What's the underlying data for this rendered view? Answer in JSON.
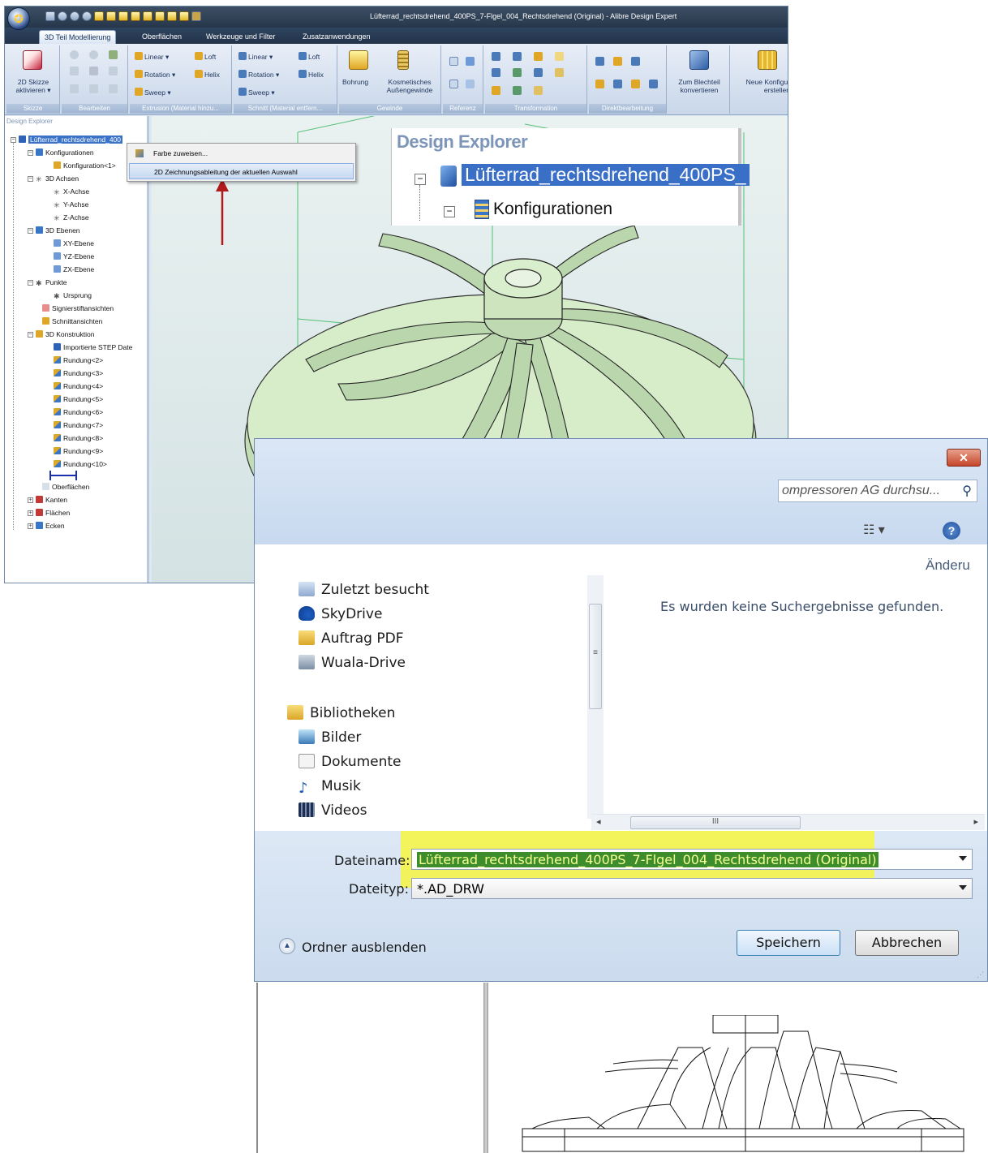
{
  "app": {
    "title": "Lüfterrad_rechtsdrehend_400PS_7-Flgel_004_Rechtsdrehend (Original) - Alibre Design Expert",
    "tabs": [
      "3D Teil Modellierung",
      "Oberflächen",
      "Werkzeuge und Filter",
      "Zusatzanwendungen"
    ],
    "ribbon": {
      "skizze_btn": "2D Skizze",
      "skizze_btn2": "aktivieren ▾",
      "ext_linear": "Linear ▾",
      "ext_rotation": "Rotation ▾",
      "ext_sweep": "Sweep ▾",
      "ext_loft": "Loft",
      "ext_helix": "Helix",
      "cut_linear": "Linear ▾",
      "cut_rotation": "Rotation ▾",
      "cut_sweep": "Sweep ▾",
      "cut_loft": "Loft",
      "cut_helix": "Helix",
      "bohrung": "Bohrung",
      "kosm1": "Kosmetisches",
      "kosm2": "Außengewinde",
      "blech1": "Zum Blechteil",
      "blech2": "konvertieren",
      "konfig1": "Neue Konfigur",
      "konfig2": "erstellen",
      "groups": [
        "Skizze",
        "Bearbeiten",
        "Extrusion (Material hinzu...",
        "Schnitt (Material entfern...",
        "Gewinde",
        "Referenz",
        "Transformation",
        "Direktbearbeitung"
      ]
    },
    "explorer": {
      "title": "Design Explorer",
      "root": "Lüfterrad_rechtsdrehend_400",
      "items": {
        "konfigurationen": "Konfigurationen",
        "konfiguration1": "Konfiguration<1>",
        "achsen": "3D Achsen",
        "x": "X-Achse",
        "y": "Y-Achse",
        "z": "Z-Achse",
        "ebenen": "3D Ebenen",
        "xy": "XY-Ebene",
        "yz": "YZ-Ebene",
        "zx": "ZX-Ebene",
        "punkte": "Punkte",
        "ursprung": "Ursprung",
        "signier": "Signierstiftansichten",
        "schnitt": "Schnittansichten",
        "konstruktion": "3D Konstruktion",
        "step": "Importierte STEP Date",
        "r2": "Rundung<2>",
        "r3": "Rundung<3>",
        "r4": "Rundung<4>",
        "r5": "Rundung<5>",
        "r6": "Rundung<6>",
        "r7": "Rundung<7>",
        "r8": "Rundung<8>",
        "r9": "Rundung<9>",
        "r10": "Rundung<10>",
        "oberflaechen": "Oberflächen",
        "kanten": "Kanten",
        "flaechen": "Flächen",
        "ecken": "Ecken"
      }
    },
    "context_menu": {
      "item1": "Farbe zuweisen...",
      "item2": "2D Zeichnungsableitung der aktuellen Auswahl"
    },
    "zoom_inset": {
      "title": "Design Explorer",
      "root": "Lüfterrad_rechtsdrehend_400PS_",
      "child": "Konfigurationen"
    }
  },
  "dialog": {
    "search_placeholder": "ompressoren AG durchsu...",
    "column_header": "Änderu",
    "nav": {
      "zuletzt": "Zuletzt besucht",
      "skydrive": "SkyDrive",
      "auftrag": "Auftrag PDF",
      "wuala": "Wuala-Drive",
      "bibliotheken": "Bibliotheken",
      "bilder": "Bilder",
      "dokumente": "Dokumente",
      "musik": "Musik",
      "videos": "Videos"
    },
    "no_results": "Es wurden keine Suchergebnisse gefunden.",
    "scroll_grip": "III",
    "filename_label": "Dateiname:",
    "filename_value": "Lüfterrad_rechtsdrehend_400PS_7-Flgel_004_Rechtsdrehend (Original)",
    "filetype_label": "Dateityp:",
    "filetype_value": "*.AD_DRW",
    "hide_folders": "Ordner ausblenden",
    "save": "Speichern",
    "cancel": "Abbrechen"
  },
  "colors": {
    "highlight_yellow": "#f7f541",
    "selection_green": "#3d8d2c",
    "model_green": "#cfe8c0",
    "arrow_red": "#b01a1a"
  }
}
